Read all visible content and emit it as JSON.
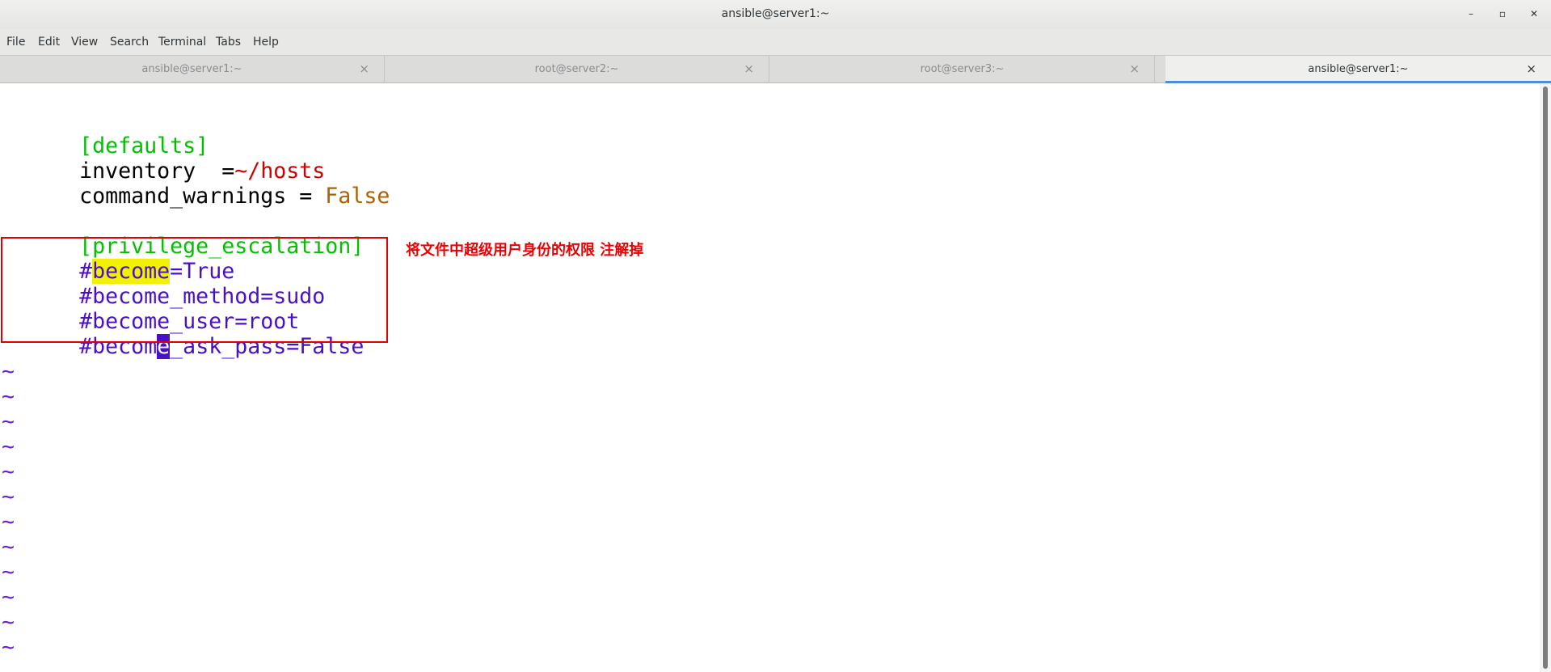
{
  "window": {
    "title": "ansible@server1:~",
    "minimize_label": "–",
    "maximize_label": "▫",
    "close_label": "✕"
  },
  "menu": [
    "File",
    "Edit",
    "View",
    "Search",
    "Terminal",
    "Tabs",
    "Help"
  ],
  "tabs": [
    {
      "label": "ansible@server1:~",
      "active": false
    },
    {
      "label": "root@server2:~",
      "active": false
    },
    {
      "label": "root@server3:~",
      "active": false
    },
    {
      "label": "ansible@server1:~",
      "active": true
    }
  ],
  "tab_close_label": "×",
  "editor": {
    "lines": {
      "defaults_header": "[defaults]",
      "inventory_key": "inventory  =",
      "inventory_val": "~/hosts",
      "command_key": "command_warnings = ",
      "command_val": "False",
      "priv_header": "[privilege_escalation]",
      "become_hash": "#",
      "become_word": "become",
      "become_rest": "=True",
      "become_method": "#become_method=sudo",
      "become_user": "#become_user=root",
      "ask_pre": "#becom",
      "ask_cursor": "e",
      "ask_post": "_ask_pass=False"
    },
    "tilde": "~",
    "tilde_count": 12
  },
  "annotation": {
    "text": "将文件中超级用户身份的权限 注解掉",
    "color": "#ee0000"
  },
  "colors": {
    "section_header": "#00c000",
    "value_red": "#d00000",
    "value_brown": "#b06000",
    "comment": "#4a10c8",
    "search_highlight": "#f2f200",
    "active_tab_accent": "#4a90d9"
  }
}
